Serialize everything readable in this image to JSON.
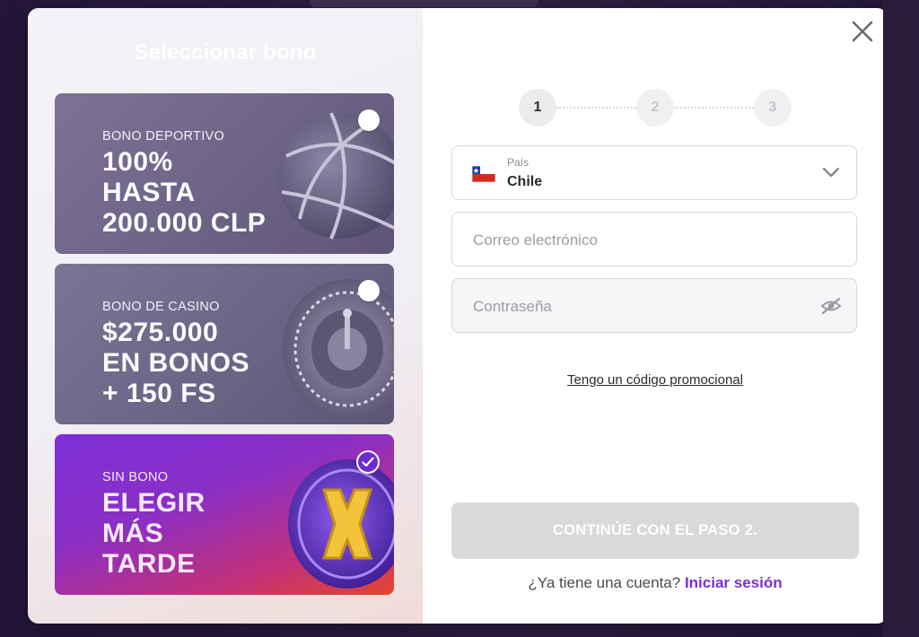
{
  "bonus_panel": {
    "title": "Seleccionar bono",
    "cards": [
      {
        "id": "sport",
        "kicker": "BONO DEPORTIVO",
        "headline_lines": [
          "100%",
          "HASTA",
          "200.000 CLP"
        ],
        "selected": false,
        "art_icon": "basketball-icon"
      },
      {
        "id": "casino",
        "kicker": "BONO DE CASINO",
        "headline_lines": [
          "$275.000",
          "EN BONOS",
          "+ 150 FS"
        ],
        "selected": false,
        "art_icon": "roulette-wheel-icon"
      },
      {
        "id": "nobono",
        "kicker": "SIN BONO",
        "headline_lines": [
          "ELEGIR",
          "MÁS",
          "TARDE"
        ],
        "selected": true,
        "art_icon": "gold-x-icon"
      }
    ]
  },
  "stepper": {
    "steps": [
      "1",
      "2",
      "3"
    ],
    "active": 1
  },
  "form": {
    "country": {
      "label": "País",
      "value": "Chile",
      "flag_icon": "chile-flag-icon"
    },
    "email": {
      "placeholder": "Correo electrónico",
      "value": ""
    },
    "password": {
      "placeholder": "Contraseña",
      "value": ""
    },
    "promo_link": "Tengo un código promocional",
    "submit_label": "CONTINÚE CON EL PASO 2.",
    "login_prompt": "¿Ya tiene una cuenta?",
    "login_link": "Iniciar sesión"
  },
  "colors": {
    "accent": "#7a2fd6",
    "submit_disabled": "#d9d9db"
  }
}
